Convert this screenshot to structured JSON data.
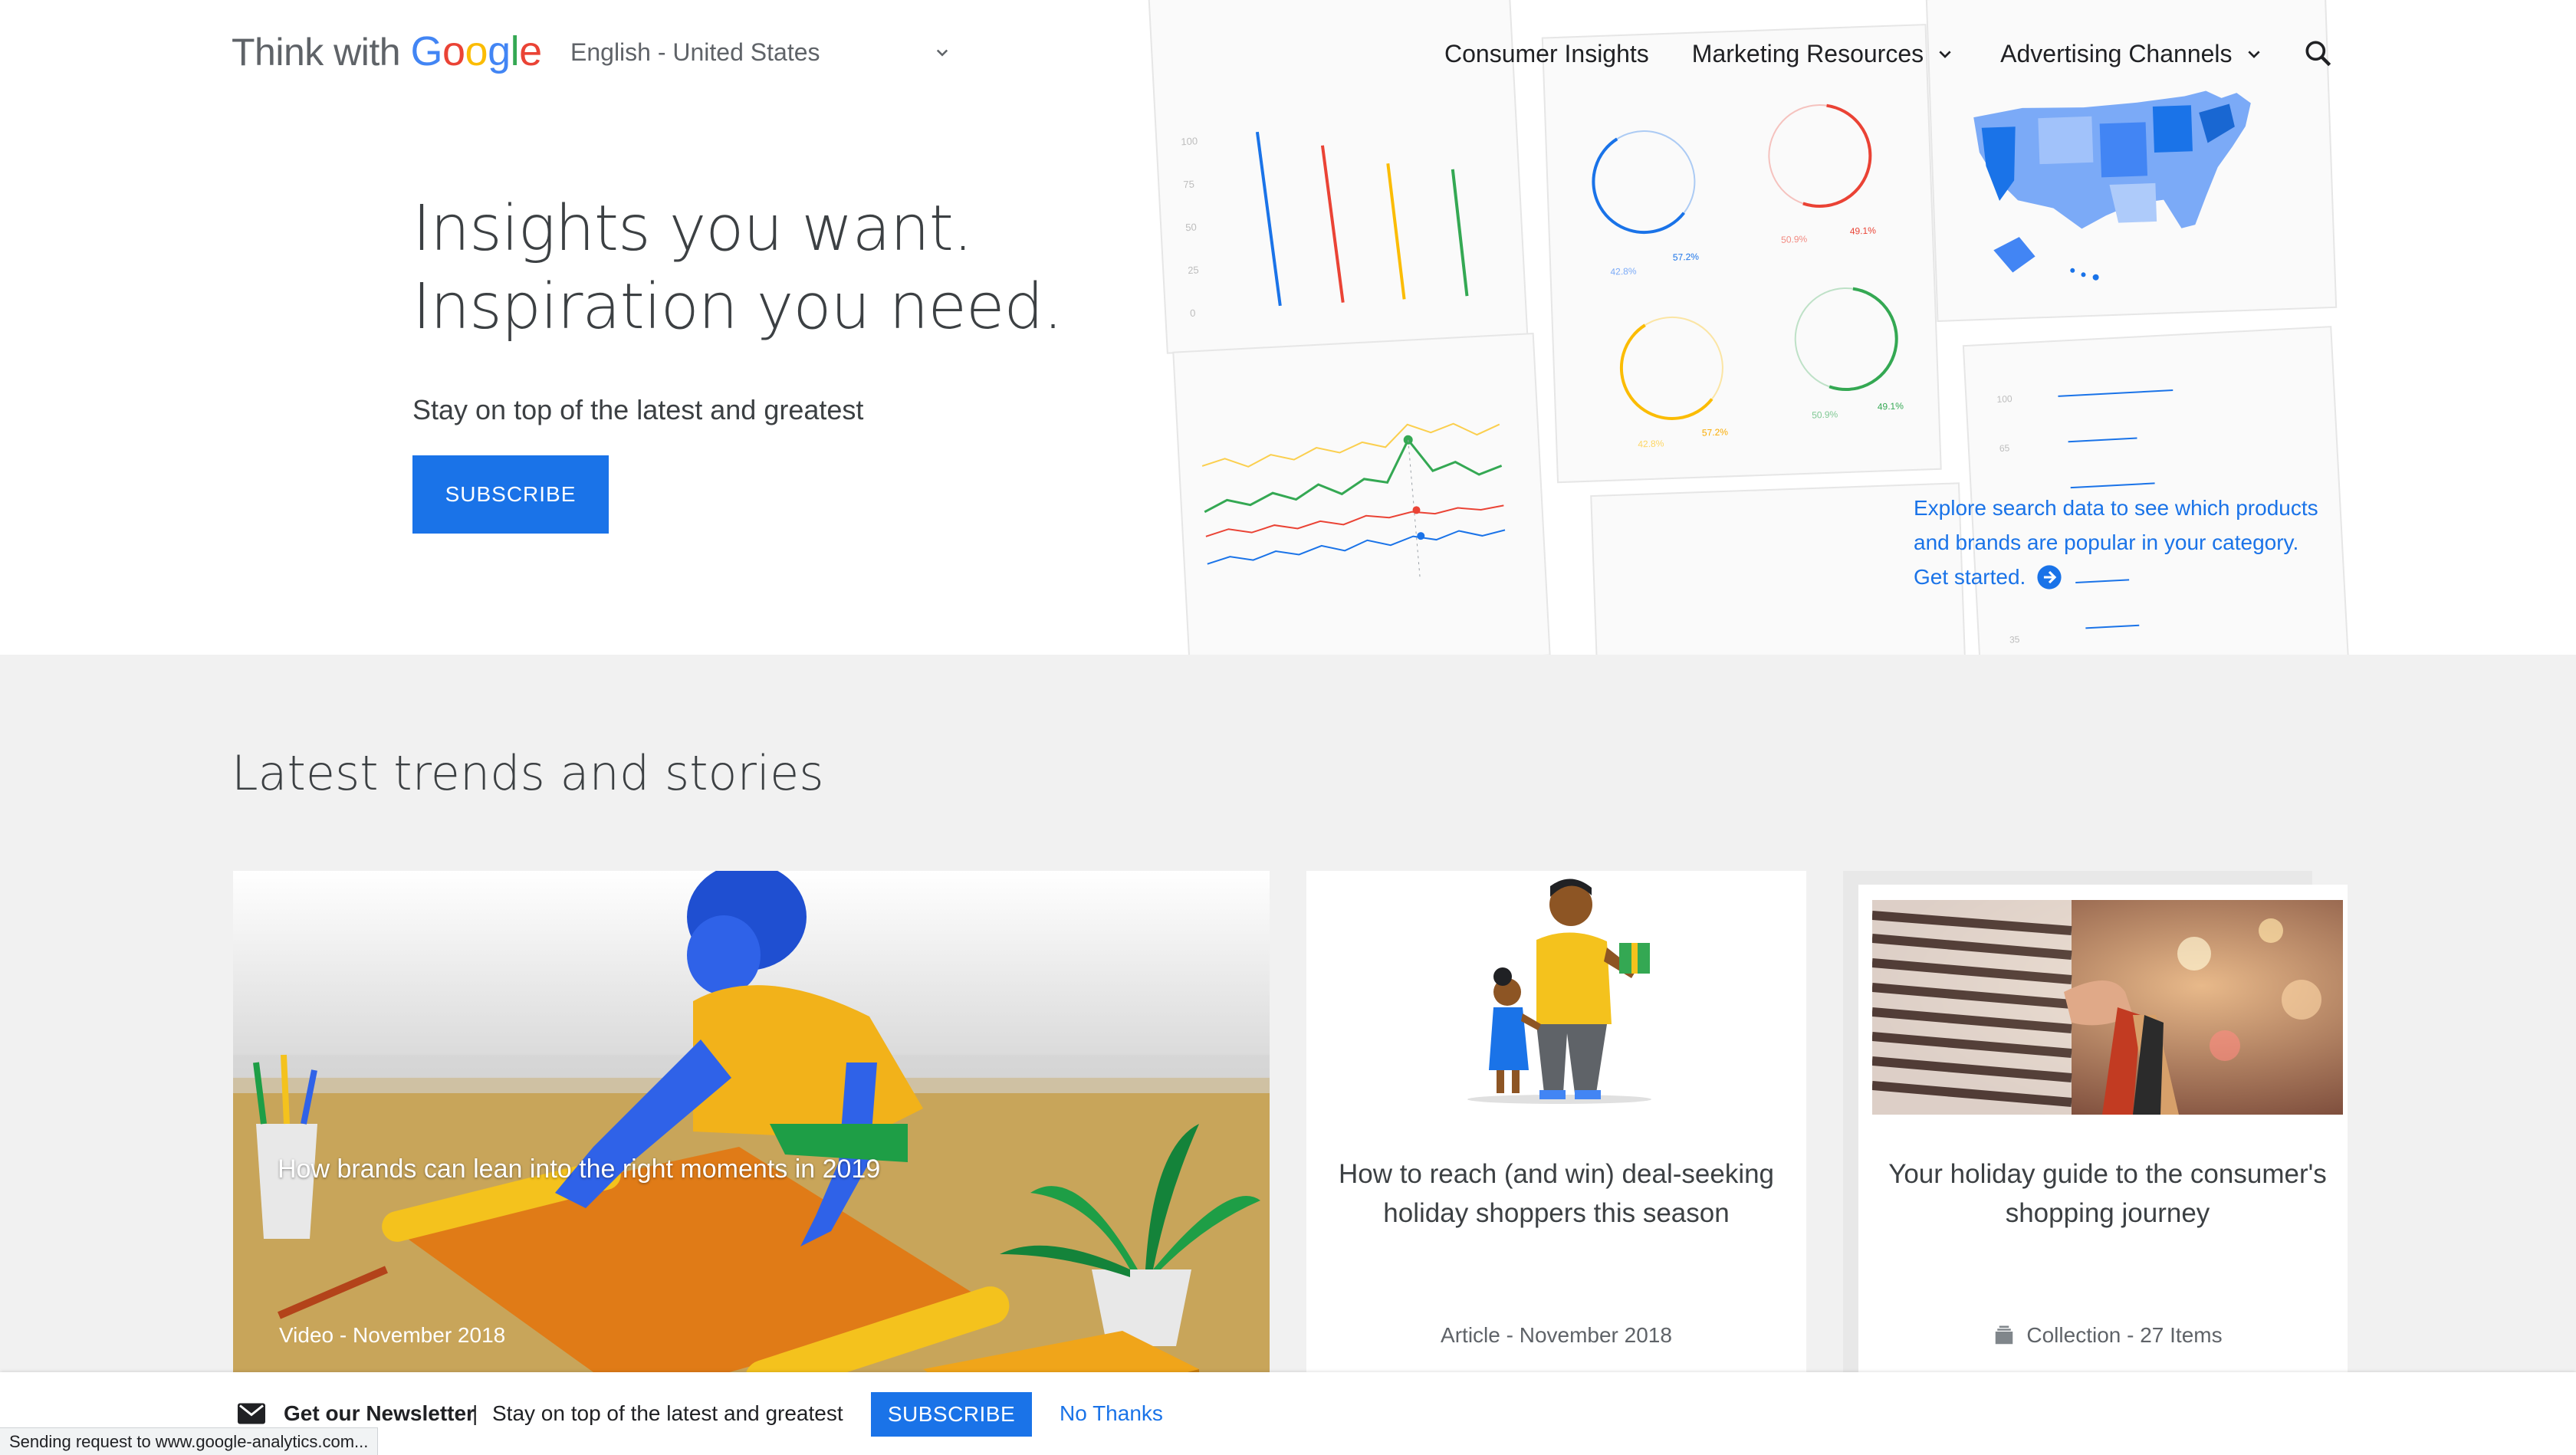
{
  "brand": {
    "prefix": "Think with",
    "word_letters": [
      "G",
      "o",
      "o",
      "g",
      "l",
      "e"
    ]
  },
  "language": {
    "selected": "English - United States"
  },
  "nav": {
    "items": [
      {
        "label": "Consumer Insights",
        "has_dropdown": false
      },
      {
        "label": "Marketing Resources",
        "has_dropdown": true
      },
      {
        "label": "Advertising Channels",
        "has_dropdown": true
      }
    ],
    "search_icon": "search-icon"
  },
  "hero": {
    "headline_line1": "Insights you want.",
    "headline_line2": "Inspiration you need.",
    "tagline": "Stay on top of the latest and greatest",
    "subscribe_label": "SUBSCRIBE",
    "collage": {
      "bar_axis_ticks": [
        "100",
        "75",
        "50",
        "25",
        "0"
      ],
      "donut_labels": [
        {
          "left": "42.8%",
          "right": "57.2%"
        },
        {
          "left": "50.9%",
          "right": "49.1%"
        },
        {
          "left": "42.8%",
          "right": "57.2%"
        },
        {
          "left": "50.9%",
          "right": "49.1%"
        }
      ],
      "list_ticks": [
        "100",
        "65",
        "35"
      ]
    },
    "promo": {
      "line1": "Explore search data to see which products",
      "line2": "and brands are popular in your category.",
      "cta": "Get started."
    }
  },
  "latest": {
    "title": "Latest trends and stories",
    "cards": [
      {
        "title": "How brands can lean into the right moments in 2019",
        "meta": "Video - November 2018"
      },
      {
        "title": "How to reach (and win) deal-seeking holiday shoppers this season",
        "meta": "Article - November 2018"
      },
      {
        "title": "Your holiday guide to the consumer's shopping journey",
        "meta": "Collection - 27 Items"
      }
    ]
  },
  "newsletter": {
    "strong": "Get our Newsletter",
    "separator": "|",
    "text": "Stay on top of the latest and greatest",
    "subscribe_label": "SUBSCRIBE",
    "dismiss_label": "No Thanks"
  },
  "status_bar": "Sending request to www.google-analytics.com...",
  "colors": {
    "accent": "#1a73e8",
    "google_blue": "#4285f4",
    "google_red": "#ea4335",
    "google_yellow": "#fbbc04",
    "google_green": "#34a853",
    "section_bg": "#f1f1f1"
  }
}
